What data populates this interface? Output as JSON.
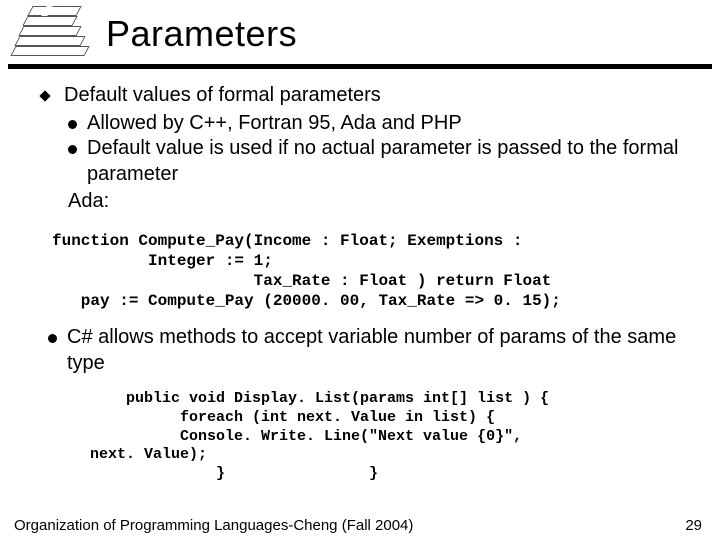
{
  "header": {
    "title": "Parameters",
    "stack_layers": [
      "",
      "",
      "",
      "",
      ""
    ]
  },
  "main": {
    "topic": "Default values of formal parameters",
    "sub": [
      "Allowed by C++, Fortran 95, Ada and PHP",
      "Default value is used if no actual parameter is passed to the formal parameter"
    ],
    "ada_label": "Ada:",
    "code_ada": "function Compute_Pay(Income : Float; Exemptions :\n          Integer := 1;\n                     Tax_Rate : Float ) return Float\n   pay := Compute_Pay (20000. 00, Tax_Rate => 0. 15);",
    "csharp_point": "C# allows methods to accept variable number of params of the same type",
    "code_cs": "    public void Display. List(params int[] list ) {\n          foreach (int next. Value in list) {\n          Console. Write. Line(\"Next value {0}\",\nnext. Value);\n              }                }"
  },
  "footer": {
    "left": "Organization of Programming Languages-Cheng (Fall 2004)",
    "page": "29"
  }
}
